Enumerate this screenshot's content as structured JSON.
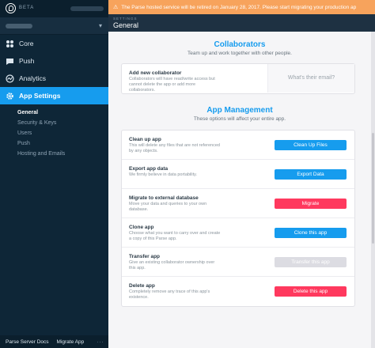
{
  "sidebar": {
    "beta_label": "BETA",
    "nav": [
      {
        "label": "Core"
      },
      {
        "label": "Push"
      },
      {
        "label": "Analytics"
      },
      {
        "label": "App Settings"
      }
    ],
    "subnav": [
      "General",
      "Security & Keys",
      "Users",
      "Push",
      "Hosting and Emails"
    ],
    "footer": {
      "docs": "Parse Server Docs",
      "migrate": "Migrate App",
      "more": "···"
    }
  },
  "banner": {
    "text": "The Parse hosted service will be retired on January 28, 2017. Please start migrating your production ap"
  },
  "topbar": {
    "section": "SETTINGS",
    "title": "General"
  },
  "collaborators": {
    "title": "Collaborators",
    "subtitle": "Team up and work together with other people.",
    "row": {
      "title": "Add new collaborator",
      "desc": "Collaborators will have read/write access but cannot delete the app or add more collaborators.",
      "placeholder": "What's their email?"
    }
  },
  "app_management": {
    "title": "App Management",
    "subtitle": "These options will affect your entire app.",
    "rows": [
      {
        "title": "Clean up app",
        "desc": "This will delete any files that are not referenced by any objects.",
        "button": "Clean Up Files"
      },
      {
        "title": "Export app data",
        "desc": "We firmly believe in data portability.",
        "button": "Export Data"
      },
      {
        "title": "Migrate to external database",
        "desc": "Move your data and queries to your own database.",
        "button": "Migrate"
      },
      {
        "title": "Clone app",
        "desc": "Choose what you want to carry over and create a copy of this Parse app.",
        "button": "Clone this app"
      },
      {
        "title": "Transfer app",
        "desc": "Give an existing collaborator ownership over this app.",
        "button": "Transfer this app"
      },
      {
        "title": "Delete app",
        "desc": "Completely remove any trace of this app's existence.",
        "button": "Delete this app"
      }
    ]
  },
  "colors": {
    "accent": "#169cee",
    "danger": "#ff395e",
    "banner": "#f7a35c",
    "sidebar": "#0e2637"
  }
}
